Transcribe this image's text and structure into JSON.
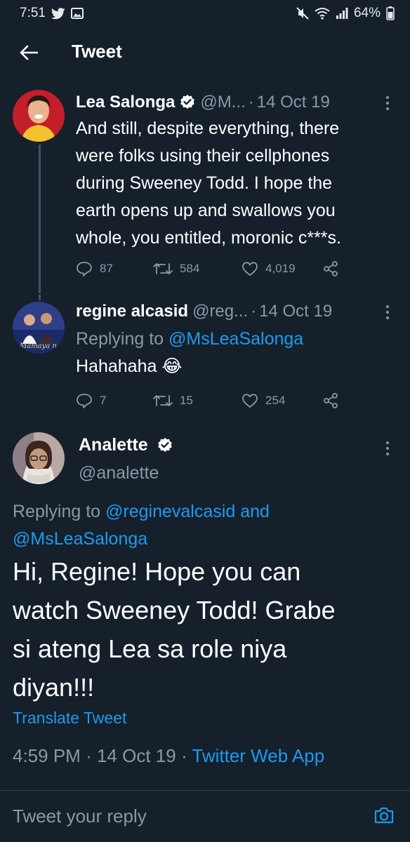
{
  "statusbar": {
    "time": "7:51",
    "battery": "64%"
  },
  "header": {
    "title": "Tweet"
  },
  "colors": {
    "background": "#15202b",
    "accent": "#1d9bf0",
    "muted": "#8899a6"
  },
  "thread": [
    {
      "name": "Lea Salonga",
      "handle": "@M...",
      "date": "14 Oct 19",
      "text_lines": [
        "And still, despite everything, there",
        "were folks using their cellphones",
        "during Sweeney Todd. I hope the",
        "earth opens up and swallows you",
        "whole, you entitled, moronic c***s."
      ],
      "replies": "87",
      "retweets": "584",
      "likes": "4,019"
    },
    {
      "name": "regine alcasid",
      "handle": "@reg...",
      "date": "14 Oct 19",
      "replying_prefix": "Replying to",
      "replying_to": "@MsLeaSalonga",
      "text": "Hahahaha 😂",
      "replies": "7",
      "retweets": "15",
      "likes": "254",
      "avatar_caption": "Mamaya na!"
    }
  ],
  "main": {
    "name": "Analette",
    "handle": "@analette",
    "replying_prefix": "Replying to",
    "replying_to_1": "@reginevalcasid",
    "replying_and": "and",
    "replying_to_2": "@MsLeaSalonga",
    "text_lines": [
      "Hi, Regine! Hope you can",
      "watch Sweeney Todd! Grabe",
      "si ateng Lea sa role niya",
      "diyan!!!"
    ],
    "translate": "Translate Tweet",
    "time": "4:59 PM",
    "date": "14 Oct 19",
    "source": "Twitter Web App"
  },
  "reply": {
    "placeholder": "Tweet your reply"
  }
}
